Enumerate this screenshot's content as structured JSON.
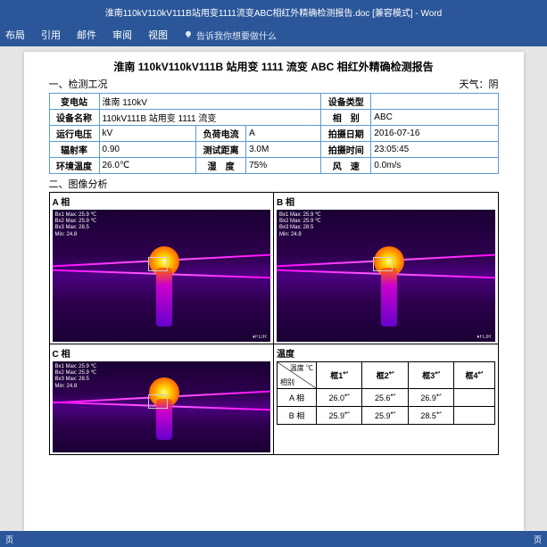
{
  "titlebar": "淮南110kV110kV111B站用变1111流变ABC相红外精确检测报告.doc [兼容模式] - Word",
  "ribbon": {
    "tabs": [
      "布局",
      "引用",
      "邮件",
      "审阅",
      "视图"
    ],
    "tell_me": "告诉我你想要做什么"
  },
  "doc": {
    "title": "淮南 110kV110kV111B 站用变 1111 流变 ABC 相红外精确检测报告",
    "sec1": "一、检测工况",
    "weather_lbl": "天气：阴",
    "info": {
      "r1": {
        "l1": "变电站",
        "v1": "淮南 110kV",
        "l2": "设备类型",
        "v2": ""
      },
      "r2": {
        "l1": "设备名称",
        "v1": "110kV111B 站用变 1111 流变",
        "l2": "相　别",
        "v2": "ABC"
      },
      "r3": {
        "l1": "运行电压",
        "v1": "kV",
        "l2": "负荷电流",
        "v2": "A",
        "l3": "拍摄日期",
        "v3": "2016-07-16"
      },
      "r4": {
        "l1": "辐射率",
        "v1": "0.90",
        "l2": "测试距离",
        "v2": "3.0M",
        "l3": "拍摄时间",
        "v3": "23:05:45"
      },
      "r5": {
        "l1": "环境温度",
        "v1": "26.0℃",
        "l2": "湿　度",
        "v2": "75%",
        "l3": "风　速",
        "v3": "0.0m/s"
      }
    },
    "sec2": "二、图像分析",
    "img_labels": {
      "a": "A 相",
      "b": "B 相",
      "c": "C 相",
      "t": "温度"
    },
    "readout": {
      "l1": "Bx1  Max: 25.9 ℃",
      "l2": "Bx2  Max: 25.9 ℃",
      "l3": "Bx3  Max: 28.5",
      "l4": "       Min: 24.8"
    },
    "flir": "♦FLIR",
    "temp_table": {
      "diag_top": "温度 ℃",
      "diag_bot": "相别",
      "cols": [
        "框1",
        "框2",
        "框3",
        "框4"
      ],
      "rows": [
        {
          "label": "A 相",
          "vals": [
            "26.0",
            "25.6",
            "26.9",
            ""
          ]
        },
        {
          "label": "B 相",
          "vals": [
            "25.9",
            "25.9",
            "28.5",
            ""
          ]
        }
      ]
    }
  },
  "status": {
    "left": "页",
    "right": "页"
  }
}
